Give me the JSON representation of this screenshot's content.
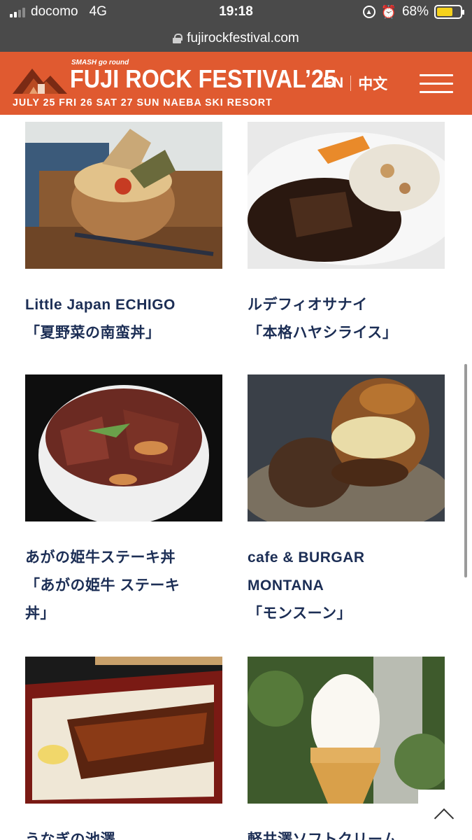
{
  "status_bar": {
    "carrier": "docomo",
    "network": "4G",
    "time": "19:18",
    "battery_percent": "68%",
    "battery_level": 0.68,
    "icons": [
      "signal-icon",
      "orientation-lock-icon",
      "alarm-icon",
      "battery-icon"
    ]
  },
  "browser": {
    "url": "fujirockfestival.com"
  },
  "header": {
    "brand_tag": "SMASH go round",
    "title": "FUJI ROCK FESTIVAL’25",
    "dates": "JULY 25 FRI 26 SAT 27 SUN  NAEBA SKI RESORT",
    "lang_en": "EN",
    "lang_zh": "中文",
    "accent_color": "#e05a30"
  },
  "items": [
    {
      "shop": "Little Japan ECHIGO",
      "dish": "「夏野菜の南蛮丼」"
    },
    {
      "shop": "ルデフィオサナイ",
      "dish": "「本格ハヤシライス」"
    },
    {
      "shop": "あがの姫牛ステーキ丼",
      "dish": "「あがの姫牛 ステーキ",
      "dish2": "丼」"
    },
    {
      "shop": "cafe & BURGAR",
      "shop2": "MONTANA",
      "dish": "「モンスーン」"
    },
    {
      "shop": "うなぎの池澤"
    },
    {
      "shop": "軽井澤ソフトクリーム"
    }
  ]
}
